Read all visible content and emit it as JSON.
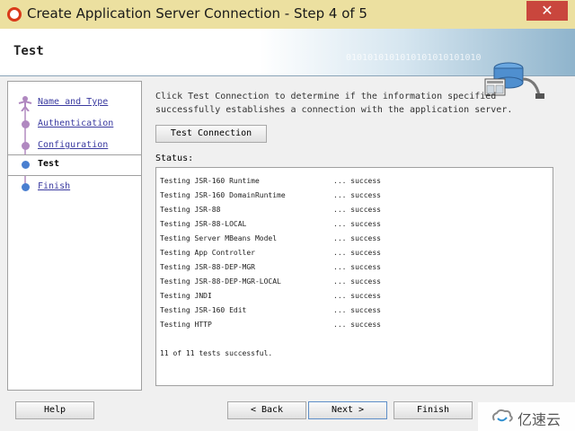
{
  "window": {
    "title": "Create Application Server Connection - Step 4 of 5",
    "close_glyph": "✕"
  },
  "banner": {
    "title": "Test",
    "binary_text": "0101010101010101010101010"
  },
  "nav": {
    "items": [
      {
        "label": "Name and Type",
        "state": "done",
        "icon": "person-icon"
      },
      {
        "label": "Authentication",
        "state": "done",
        "icon": "step-dot-icon"
      },
      {
        "label": "Configuration",
        "state": "done",
        "icon": "step-dot-icon"
      },
      {
        "label": "Test",
        "state": "current",
        "icon": "step-dot-icon"
      },
      {
        "label": "Finish",
        "state": "todo",
        "icon": "step-dot-icon"
      }
    ]
  },
  "instructions": "Click Test Connection to determine if the information specified successfully establishes a connection with the application server.",
  "test_button": "Test Connection",
  "status_label": "Status:",
  "results": [
    {
      "test": "Testing JSR-160 Runtime",
      "result": "... success"
    },
    {
      "test": "Testing JSR-160 DomainRuntime",
      "result": "... success"
    },
    {
      "test": "Testing JSR-88",
      "result": "... success"
    },
    {
      "test": "Testing JSR-88-LOCAL",
      "result": "... success"
    },
    {
      "test": "Testing Server MBeans Model",
      "result": "... success"
    },
    {
      "test": "Testing App Controller",
      "result": "... success"
    },
    {
      "test": "Testing JSR-88-DEP-MGR",
      "result": "... success"
    },
    {
      "test": "Testing JSR-88-DEP-MGR-LOCAL",
      "result": "... success"
    },
    {
      "test": "Testing JNDI",
      "result": "... success"
    },
    {
      "test": "Testing JSR-160 Edit",
      "result": "... success"
    },
    {
      "test": "Testing HTTP",
      "result": "... success"
    }
  ],
  "summary": "11 of 11 tests successful.",
  "buttons": {
    "help": "Help",
    "back": "< Back",
    "next": "Next >",
    "finish": "Finish"
  },
  "watermark": {
    "text": "亿速云"
  },
  "colors": {
    "title_bar": "#ece0a0",
    "close": "#c9463d",
    "link": "#3a3aa0"
  }
}
